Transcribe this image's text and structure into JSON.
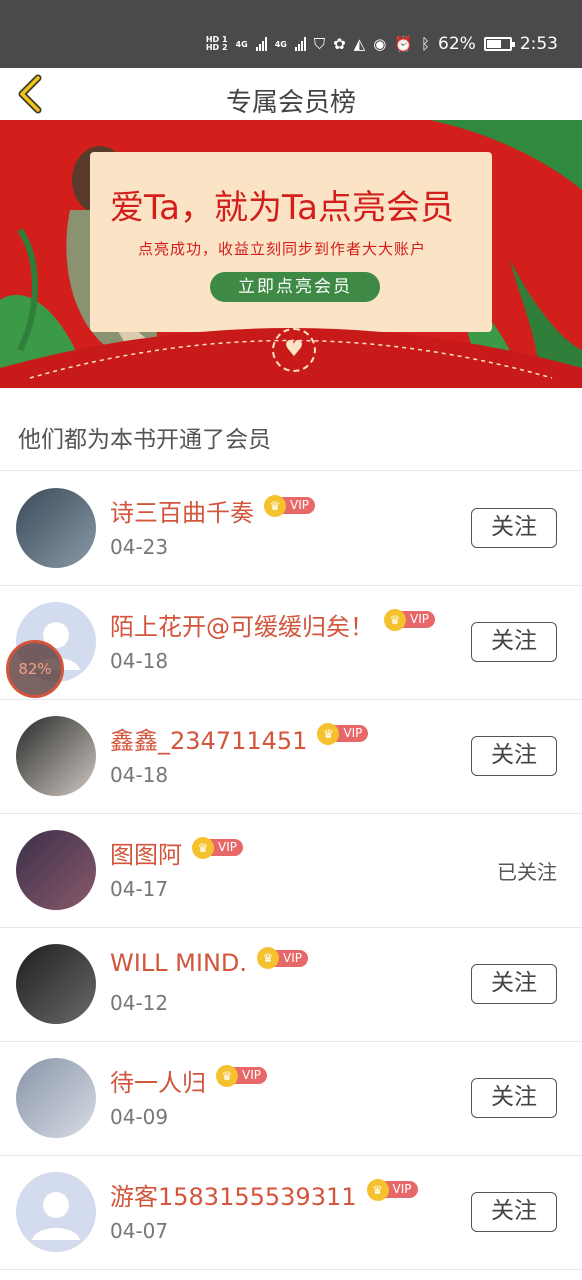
{
  "status_bar": {
    "hd1": "HD 1",
    "hd2": "HD 2",
    "net1": "4G",
    "net2": "4G",
    "battery": "62%",
    "battery_level": 0.62,
    "time": "2:53"
  },
  "header": {
    "title": "专属会员榜",
    "back_icon": "chevron-left-icon"
  },
  "banner": {
    "headline": "爱Ta，就为Ta点亮会员",
    "subtitle": "点亮成功，收益立刻同步到作者大大账户",
    "button_label": "立即点亮会员",
    "colors": {
      "background": "#d21f1c",
      "card": "#fbe3c6",
      "button": "#3e8a44"
    }
  },
  "section": {
    "title": "他们都为本书开通了会员"
  },
  "vip_label": "VIP",
  "members": [
    {
      "name": "诗三百曲千奏",
      "date": "04-23",
      "action": "关注",
      "followed": false
    },
    {
      "name": "陌上花开@可缓缓归矣！",
      "date": "04-18",
      "action": "关注",
      "followed": false
    },
    {
      "name": "鑫鑫_234711451",
      "date": "04-18",
      "action": "关注",
      "followed": false
    },
    {
      "name": "图图阿",
      "date": "04-17",
      "action": "已关注",
      "followed": true
    },
    {
      "name": "WILL MIND.",
      "date": "04-12",
      "action": "关注",
      "followed": false
    },
    {
      "name": "待一人归",
      "date": "04-09",
      "action": "关注",
      "followed": false
    },
    {
      "name": "游客1583155539311",
      "date": "04-07",
      "action": "关注",
      "followed": false
    }
  ],
  "float_progress": "82%",
  "colors": {
    "accent": "#d2553c",
    "vip_tag": "#e8686a",
    "crown": "#f5c12e"
  }
}
